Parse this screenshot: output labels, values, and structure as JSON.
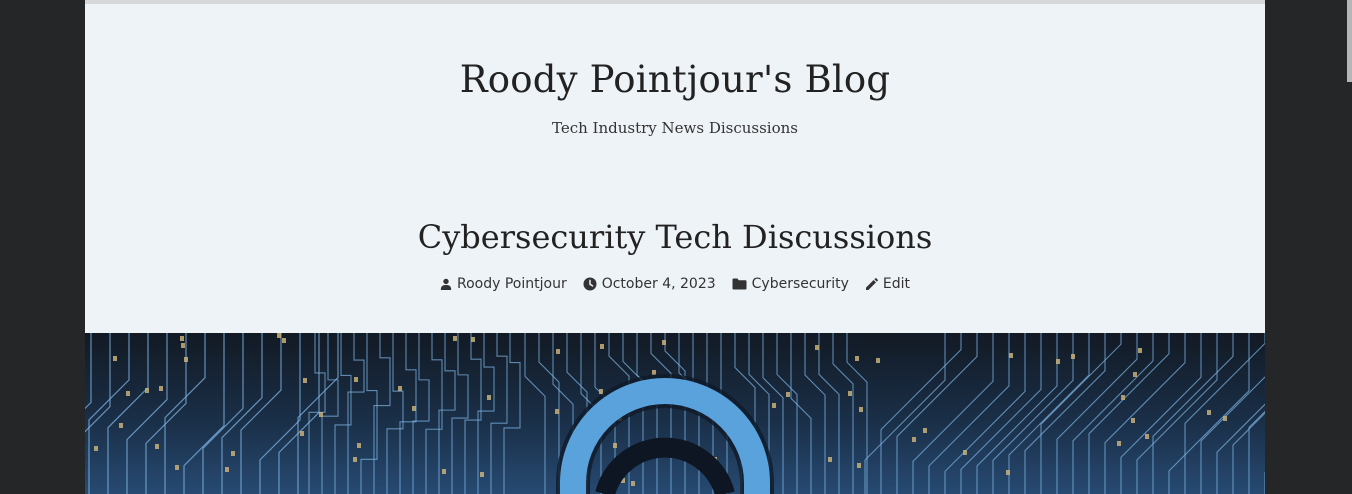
{
  "site": {
    "title": "Roody Pointjour's Blog",
    "description": "Tech Industry News Discussions"
  },
  "post": {
    "title": "Cybersecurity Tech Discussions",
    "meta": {
      "author": "Roody Pointjour",
      "date": "October 4, 2023",
      "category": "Cybersecurity",
      "edit_label": "Edit"
    }
  },
  "hero": {
    "image_subject": "circuit-board-with-padlock",
    "colors": {
      "background": "#1a2f48",
      "trace": "#7fb6e6",
      "pad": "#c8b078",
      "lock": "#5aa2dc"
    }
  },
  "colors": {
    "outer_background": "#252627",
    "page_background": "#eef3f7",
    "text": "#222222"
  }
}
